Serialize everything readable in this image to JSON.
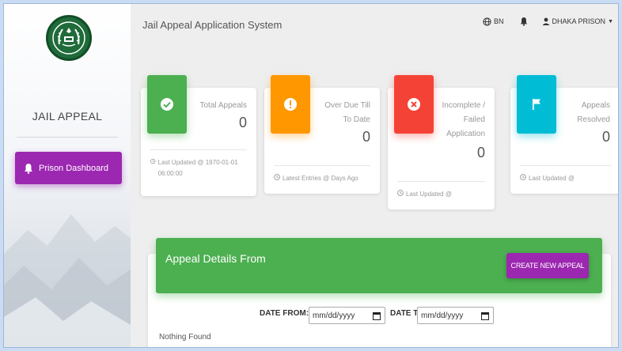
{
  "app": {
    "title": "Jail Appeal Application System"
  },
  "sidebar": {
    "brand": "JAIL APPEAL",
    "nav": [
      {
        "label": "Prison Dashboard"
      }
    ]
  },
  "topnav": {
    "language": "BN",
    "user": "DHAKA PRISON"
  },
  "cards": [
    {
      "label": "Total Appeals",
      "value": "0",
      "footer": "Last Updated @ 1970-01-01 06:00:00",
      "color": "#4caf50",
      "icon": "check-circle-icon"
    },
    {
      "label": "Over Due Till To Date",
      "value": "0",
      "footer": "Latest Entries @ Days Ago",
      "color": "#ff9800",
      "icon": "exclamation-circle-icon"
    },
    {
      "label": "Incomplete / Failed Application",
      "value": "0",
      "footer": "Last Updated @",
      "color": "#f44336",
      "icon": "x-circle-icon"
    },
    {
      "label": "Appeals Resolved",
      "value": "0",
      "footer": "Last Updated @",
      "color": "#00bcd4",
      "icon": "flag-icon"
    }
  ],
  "appeal": {
    "title": "Appeal Details From",
    "create_label": "CREATE NEW APPEAL",
    "date_from_label": "DATE FROM:",
    "date_to_label": "DATE TO:",
    "date_placeholder": "mm/dd/yyyy",
    "empty_text": "Nothing Found"
  },
  "colors": {
    "accent": "#9c27b0",
    "panel": "#4caf50"
  }
}
